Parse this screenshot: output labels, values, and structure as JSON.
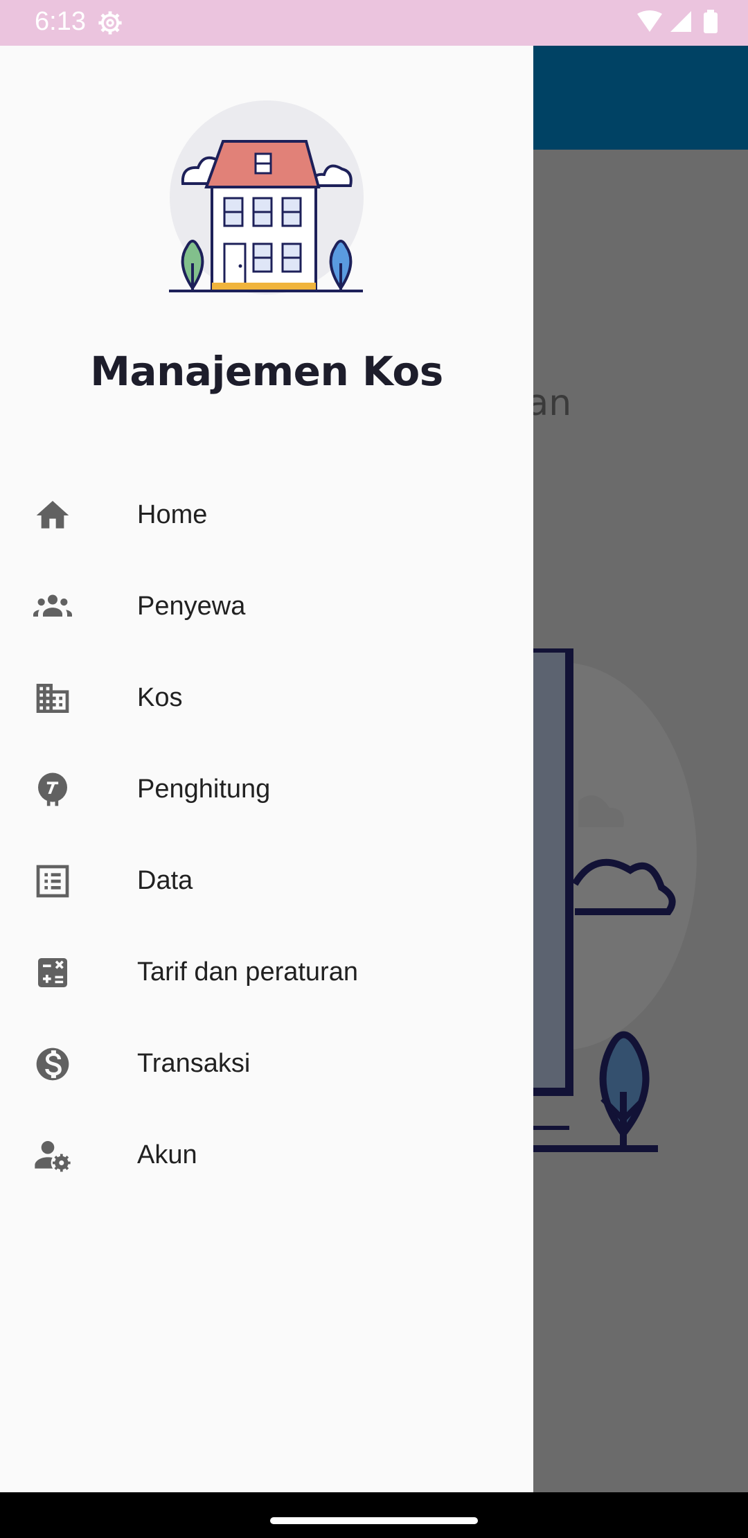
{
  "status_bar": {
    "time": "6:13",
    "icons": [
      "settings-gear-icon",
      "wifi-icon",
      "signal-icon",
      "battery-icon"
    ]
  },
  "background": {
    "partial_text": "udah dan",
    "toolbar_color": "#004264"
  },
  "drawer": {
    "title": "Manajemen Kos",
    "logo": "house-illustration",
    "menu": [
      {
        "label": "Home",
        "icon": "home-icon"
      },
      {
        "label": "Penyewa",
        "icon": "people-group-icon"
      },
      {
        "label": "Kos",
        "icon": "building-icon"
      },
      {
        "label": "Penghitung",
        "icon": "meter-icon"
      },
      {
        "label": "Data",
        "icon": "list-document-icon"
      },
      {
        "label": "Tarif dan peraturan",
        "icon": "calculator-icon"
      },
      {
        "label": "Transaksi",
        "icon": "dollar-circle-icon"
      },
      {
        "label": "Akun",
        "icon": "user-settings-icon"
      }
    ]
  },
  "colors": {
    "status_bar": "#ebc4de",
    "drawer_bg": "#fafafa",
    "scrim": "#6b6b6b",
    "icon": "#616161",
    "text": "#212121"
  }
}
